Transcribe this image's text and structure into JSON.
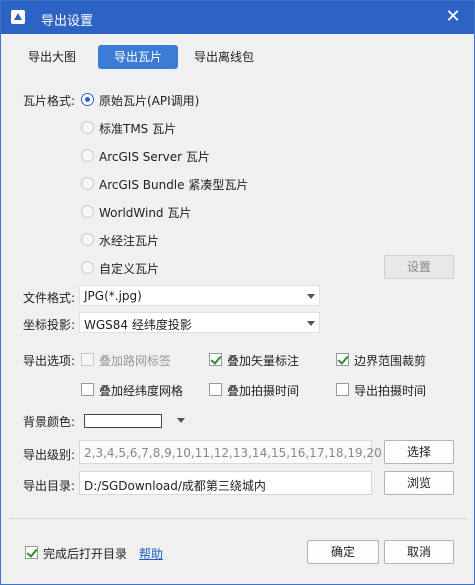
{
  "window": {
    "title": "导出设置",
    "close_glyph": "✕"
  },
  "tabs": [
    "导出大图",
    "导出瓦片",
    "导出离线包"
  ],
  "tile_format": {
    "label": "瓦片格式:",
    "options": [
      "原始瓦片(API调用)",
      "标准TMS 瓦片",
      "ArcGIS Server 瓦片",
      "ArcGIS Bundle 紧凑型瓦片",
      "WorldWind 瓦片",
      "水经注瓦片",
      "自定义瓦片"
    ],
    "selected_index": 0,
    "settings_button": "设置"
  },
  "file_format": {
    "label": "文件格式:",
    "value": "JPG(*.jpg)"
  },
  "projection": {
    "label": "坐标投影:",
    "value": "WGS84 经纬度投影"
  },
  "export_options": {
    "label": "导出选项:",
    "items": [
      {
        "label": "叠加路网标签",
        "checked": false,
        "disabled": true
      },
      {
        "label": "叠加矢量标注",
        "checked": true,
        "disabled": false
      },
      {
        "label": "边界范围裁剪",
        "checked": true,
        "disabled": false
      },
      {
        "label": "叠加经纬度网格",
        "checked": false,
        "disabled": false
      },
      {
        "label": "叠加拍摄时间",
        "checked": false,
        "disabled": false
      },
      {
        "label": "导出拍摄时间",
        "checked": false,
        "disabled": false
      }
    ]
  },
  "background_color": {
    "label": "背景颜色:",
    "color": "#ffffff"
  },
  "export_levels": {
    "label": "导出级别:",
    "value": "2,3,4,5,6,7,8,9,10,11,12,13,14,15,16,17,18,19,20",
    "button": "选择"
  },
  "export_dir": {
    "label": "导出目录:",
    "value": "D:/SGDownload/成都第三绕城内",
    "button": "浏览"
  },
  "footer": {
    "open_dir_label": "完成后打开目录",
    "open_dir_checked": true,
    "help_link": "帮助",
    "ok_button": "确定",
    "cancel_button": "取消"
  },
  "colors": {
    "title_bar": "#2d63c4",
    "tab_active": "#3a7bd5",
    "check": "#2e8a2e",
    "link": "#1e5fc8"
  },
  "icons": {
    "app": "window-app-icon",
    "close": "close-icon"
  }
}
